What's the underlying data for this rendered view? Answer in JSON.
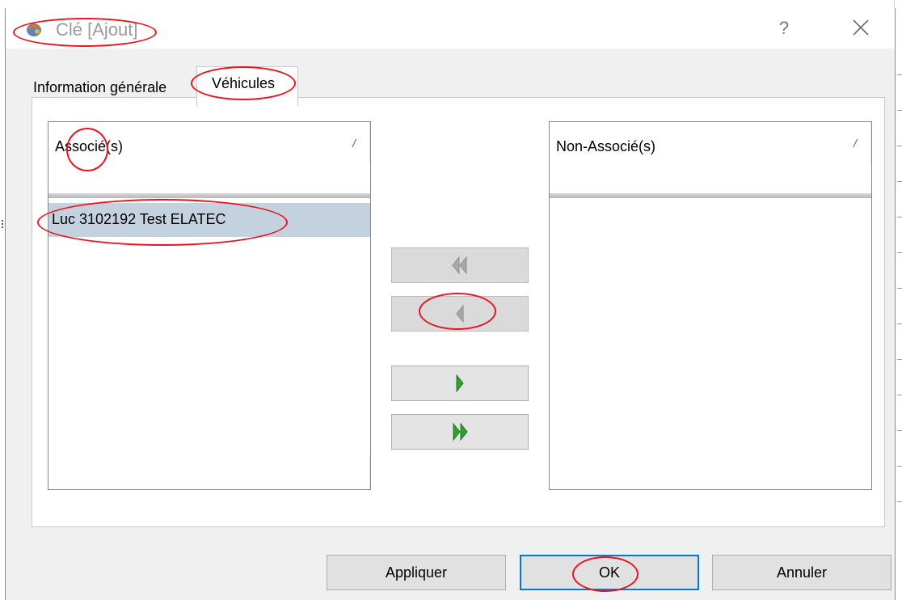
{
  "window": {
    "title": "Clé [Ajout]",
    "help_label": "?"
  },
  "tabs": [
    {
      "label": "Information générale",
      "selected": false
    },
    {
      "label": "Véhicules",
      "selected": true
    }
  ],
  "associated": {
    "header": "Associé(s)",
    "items": [
      "Luc 3102192 Test ELATEC"
    ]
  },
  "unassociated": {
    "header": "Non-Associé(s)",
    "items": []
  },
  "move_buttons": [
    {
      "name": "move-all-left",
      "icon": "double-left-arrow-icon",
      "enabled": false
    },
    {
      "name": "move-left",
      "icon": "left-arrow-icon",
      "enabled": false
    },
    {
      "name": "move-right",
      "icon": "right-arrow-icon",
      "enabled": true
    },
    {
      "name": "move-all-right",
      "icon": "double-right-arrow-icon",
      "enabled": true
    }
  ],
  "buttons": {
    "apply": "Appliquer",
    "ok": "OK",
    "cancel": "Annuler"
  },
  "colors": {
    "annotation": "#e8141e",
    "selection": "#c4d2e0",
    "ok_focus": "#0078d7",
    "arrow_disabled": "#a8a8a8",
    "arrow_enabled": "#2fa12f"
  }
}
